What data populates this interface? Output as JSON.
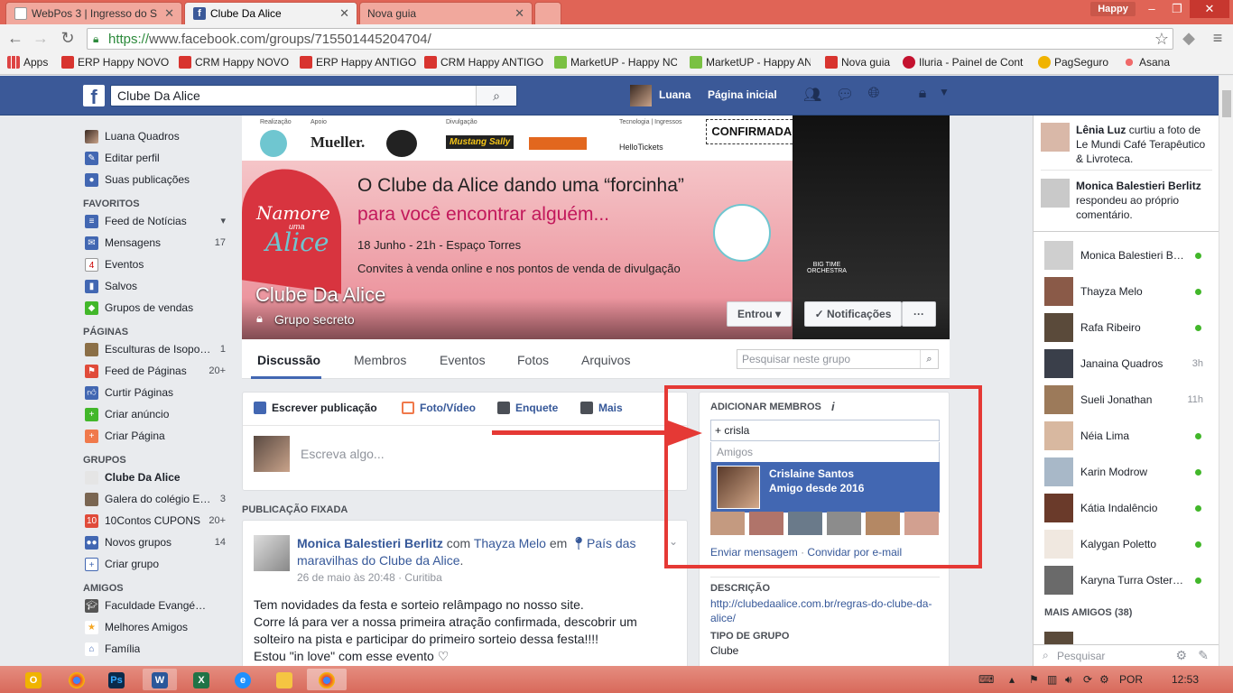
{
  "browser": {
    "tabs": [
      {
        "label": "WebPos 3 | Ingresso do S",
        "active": false
      },
      {
        "label": "Clube Da Alice",
        "active": true
      },
      {
        "label": "Nova guia",
        "active": false
      }
    ],
    "profile": "Happy",
    "url_scheme": "https://",
    "url_rest": "www.facebook.com/groups/715501445204704/",
    "bookmarks": [
      "Apps",
      "ERP Happy NOVO",
      "CRM Happy NOVO",
      "ERP Happy ANTIGO",
      "CRM Happy ANTIGO",
      "MarketUP - Happy NC",
      "MarketUP - Happy AN",
      "Nova guia",
      "Iluria - Painel de Cont",
      "PagSeguro",
      "Asana"
    ]
  },
  "header": {
    "search_value": "Clube Da Alice",
    "user": "Luana",
    "home": "Página inicial"
  },
  "leftnav": {
    "top": [
      {
        "label": "Luana Quadros"
      },
      {
        "label": "Editar perfil"
      },
      {
        "label": "Suas publicações"
      }
    ],
    "favoritos_head": "FAVORITOS",
    "favoritos": [
      {
        "label": "Feed de Notícias",
        "count": "▾"
      },
      {
        "label": "Mensagens",
        "count": "17"
      },
      {
        "label": "Eventos",
        "count": ""
      },
      {
        "label": "Salvos",
        "count": ""
      },
      {
        "label": "Grupos de vendas",
        "count": ""
      }
    ],
    "paginas_head": "PÁGINAS",
    "paginas": [
      {
        "label": "Esculturas de Isopo…",
        "count": "1"
      },
      {
        "label": "Feed de Páginas",
        "count": "20+"
      },
      {
        "label": "Curtir Páginas",
        "count": ""
      },
      {
        "label": "Criar anúncio",
        "count": ""
      },
      {
        "label": "Criar Página",
        "count": ""
      }
    ],
    "grupos_head": "GRUPOS",
    "grupos": [
      {
        "label": "Clube Da Alice",
        "count": ""
      },
      {
        "label": "Galera do colégio E…",
        "count": "3"
      },
      {
        "label": "10Contos CUPONS",
        "count": "20+"
      },
      {
        "label": "Novos grupos",
        "count": "14"
      },
      {
        "label": "Criar grupo",
        "count": ""
      }
    ],
    "amigos_head": "AMIGOS",
    "amigos": [
      {
        "label": "Faculdade Evangé…",
        "count": ""
      },
      {
        "label": "Melhores Amigos",
        "count": ""
      },
      {
        "label": "Família",
        "count": ""
      }
    ]
  },
  "cover": {
    "sponsor_labels": [
      "Realização",
      "Apoio",
      "Divulgação",
      "Tecnologia | Ingressos"
    ],
    "sponsors": [
      "Mueller.",
      "Mustang Sally",
      "HelloTickets"
    ],
    "confirm": "CONFIRMADA!",
    "line1": "O Clube da Alice dando uma “forcinha”",
    "line2": "para você encontrar alguém...",
    "line3": "18 Junho - 21h - Espaço Torres",
    "line4": "Convites à venda online e nos pontos de venda de divulgação",
    "heart_text1": "Namore",
    "heart_text2": "uma",
    "heart_text3": "Alice",
    "band": "BIG TIME ORCHESTRA"
  },
  "group": {
    "title": "Clube Da Alice",
    "privacy": "Grupo secreto",
    "btn_joined": "Entrou ▾",
    "btn_notif": "✓ Notificações",
    "btn_more": "···",
    "tabs": [
      "Discussão",
      "Membros",
      "Eventos",
      "Fotos",
      "Arquivos"
    ],
    "search_placeholder": "Pesquisar neste grupo"
  },
  "composer": {
    "actions": [
      "Escrever publicação",
      "Foto/Vídeo",
      "Enquete",
      "Mais"
    ],
    "placeholder": "Escreva algo..."
  },
  "pinned": {
    "head": "PUBLICAÇÃO FIXADA",
    "author": "Monica Balestieri Berlitz",
    "with_word": "com",
    "with_name": "Thayza Melo",
    "at_word": "em",
    "place": "País das maravilhas do Clube da Alice",
    "time": "26 de maio às 20:48 · Curitiba",
    "body1": "Tem novidades da festa e sorteio relâmpago no nosso site.",
    "body2": "Corre lá para ver a nossa primeira atração confirmada, descobrir um solteiro na pista e participar do primeiro sorteio dessa festa!!!!",
    "body3": "Estou \"in love\" com esse evento ♡"
  },
  "add_members": {
    "head": "ADICIONAR MEMBROS",
    "input_value": "+ crisla",
    "group_label": "Amigos",
    "suggest_name": "Crislaine Santos",
    "suggest_sub": "Amigo desde 2016",
    "link_msg": "Enviar mensagem",
    "link_sep": "·",
    "link_invite": "Convidar por e-mail",
    "desc_head": "DESCRIÇÃO",
    "desc_link": "http://clubedaalice.com.br/regras-do-clube-da-alice/",
    "type_head": "TIPO DE GRUPO",
    "type_value": "Clube"
  },
  "ticker": [
    {
      "name": "Lênia Luz",
      "text": "curtiu a foto de Le Mundi Café Terapêutico & Livroteca."
    },
    {
      "name": "Monica Balestieri Berlitz",
      "text": "respondeu ao próprio comentário."
    }
  ],
  "chat": [
    {
      "name": "Monica Balestieri B…",
      "status": ""
    },
    {
      "name": "Thayza Melo",
      "status": ""
    },
    {
      "name": "Rafa Ribeiro",
      "status": ""
    },
    {
      "name": "Janaina Quadros",
      "status": "3h"
    },
    {
      "name": "Sueli Jonathan",
      "status": "11h"
    },
    {
      "name": "Néia Lima",
      "status": ""
    },
    {
      "name": "Karin Modrow",
      "status": ""
    },
    {
      "name": "Kátia Indalêncio",
      "status": ""
    },
    {
      "name": "Kalygan Poletto",
      "status": ""
    },
    {
      "name": "Karyna Turra Ostern…",
      "status": ""
    }
  ],
  "chat_more": "MAIS AMIGOS (38)",
  "chat_search": "Pesquisar",
  "taskbar": {
    "lang": "POR",
    "clock": "12:53"
  },
  "colors": {
    "fb_blue": "#3b5998",
    "highlight": "#4267b2",
    "annotation_red": "#e53935",
    "online_green": "#42b72a"
  }
}
